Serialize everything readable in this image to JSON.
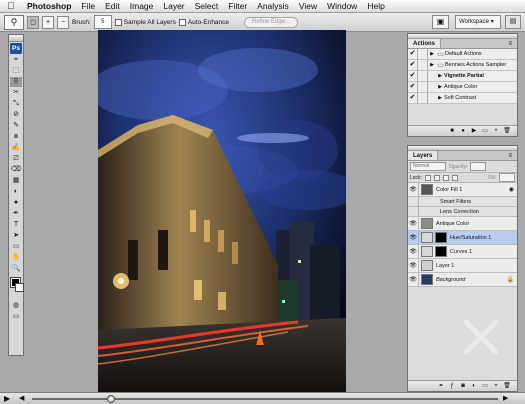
{
  "menubar": {
    "apple": "",
    "items": [
      "Photoshop",
      "File",
      "Edit",
      "Image",
      "Layer",
      "Select",
      "Filter",
      "Analysis",
      "View",
      "Window",
      "Help"
    ]
  },
  "options_bar": {
    "brush_label": "Brush:",
    "brush_size": "5",
    "sample_all_layers": "Sample All Layers",
    "auto_enhance": "Auto-Enhance",
    "refine_edge": "Refine Edge...",
    "workspace": "Workspace ▾"
  },
  "toolbox": {
    "logo": "Ps",
    "tools": [
      "⌖",
      "⬚",
      "⚲",
      "✂",
      "⤡",
      "⊘",
      "✎",
      "⧈",
      "✍",
      "⎚",
      "⌫",
      "▦",
      "◐",
      "●",
      "✒",
      "T",
      "➤",
      "▭",
      "✋",
      "🔍"
    ],
    "tool_names": [
      "move-tool",
      "marquee-tool",
      "lasso-tool",
      "crop-tool",
      "slice-tool",
      "healing-tool",
      "brush-tool",
      "clone-stamp-tool",
      "history-brush-tool",
      "eraser-tool",
      "gradient-tool",
      "blur-tool",
      "dodge-tool",
      "pen-tool",
      "type-tool",
      "path-select-tool",
      "shape-tool",
      "notes-tool",
      "hand-tool",
      "zoom-tool"
    ],
    "selected_index": 2
  },
  "actions_panel": {
    "tabs": [
      "Actions"
    ],
    "rows": [
      {
        "label": "Default Actions",
        "check": "✔",
        "indent": 0,
        "folder": true,
        "highlight": false
      },
      {
        "label": "Bennies Actions Sampler",
        "check": "✔",
        "indent": 0,
        "folder": true,
        "highlight": false
      },
      {
        "label": "Vignette Partial",
        "check": "✔",
        "indent": 1,
        "folder": false,
        "highlight": true
      },
      {
        "label": "Antique Color",
        "check": "✔",
        "indent": 1,
        "folder": false,
        "highlight": false
      },
      {
        "label": "Soft Contrast",
        "check": "✔",
        "indent": 1,
        "folder": false,
        "highlight": false
      }
    ]
  },
  "layers_panel": {
    "tabs": [
      "Layers"
    ],
    "blend_mode": "Normal",
    "opacity_label": "Opacity:",
    "lock_label": "Lock:",
    "fill_label": "Fill:",
    "layers": [
      {
        "label": "Color Fill 1",
        "type": "fill",
        "sub": false,
        "selected": false,
        "fx": true,
        "italic": false,
        "thumb": "#555555"
      },
      {
        "label": "Smart Filters",
        "type": "sub",
        "sub": true,
        "selected": false,
        "fx": false,
        "italic": false,
        "thumb": ""
      },
      {
        "label": "Lens Correction",
        "type": "sub",
        "sub": true,
        "selected": false,
        "fx": false,
        "italic": false,
        "thumb": ""
      },
      {
        "label": "Antique Color",
        "type": "group",
        "sub": false,
        "selected": false,
        "fx": false,
        "italic": false,
        "thumb": "#8c8c8c"
      },
      {
        "label": "Hue/Saturation 1",
        "type": "adjust",
        "sub": false,
        "selected": true,
        "fx": false,
        "italic": false,
        "thumb": "#d8d8d8"
      },
      {
        "label": "Curves 1",
        "type": "adjust",
        "sub": false,
        "selected": false,
        "fx": false,
        "italic": false,
        "thumb": "#d8d8d8"
      },
      {
        "label": "Layer 1",
        "type": "pixel",
        "sub": false,
        "selected": false,
        "fx": false,
        "italic": false,
        "thumb": "#cfcfcf"
      },
      {
        "label": "Background",
        "type": "background",
        "sub": false,
        "selected": false,
        "fx": false,
        "italic": true,
        "thumb": "#2c3a6a"
      }
    ]
  },
  "playback": {
    "play": "▶",
    "back": "◀",
    "forward": "▶",
    "progress": 0.17
  },
  "colors": {
    "selection": "#b8ccf0",
    "sky": "#1e3270",
    "ps_logo": "#1d4ea6"
  }
}
